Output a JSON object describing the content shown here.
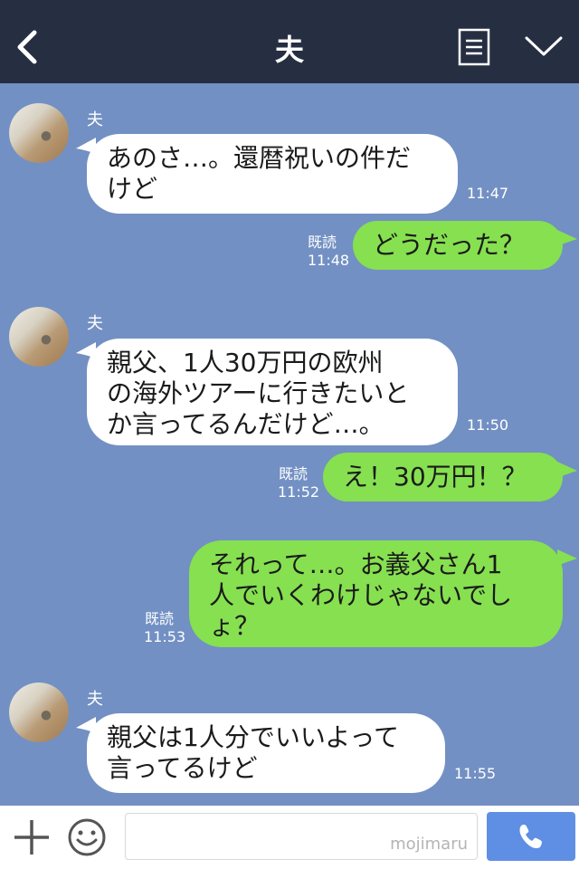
{
  "header": {
    "title": "夫"
  },
  "messages": [
    {
      "sender": "夫",
      "text": "あのさ…。還暦祝いの件だ\nけど",
      "time": "11:47"
    },
    {
      "text": "どうだった？",
      "read": "既読",
      "time": "11:48"
    },
    {
      "sender": "夫",
      "text": "親父、1人30万円の欧州\nの海外ツアーに行きたいと\nか言ってるんだけど…。",
      "time": "11:50"
    },
    {
      "text": "え！30万円！？",
      "read": "既読",
      "time": "11:52"
    },
    {
      "text": "それって…。お義父さん1\n人でいくわけじゃないでし\nょ？",
      "read": "既読",
      "time": "11:53"
    },
    {
      "sender": "夫",
      "text": "親父は1人分でいいよって\n言ってるけど",
      "time": "11:55"
    }
  ],
  "input": {
    "watermark": "mojimaru"
  }
}
